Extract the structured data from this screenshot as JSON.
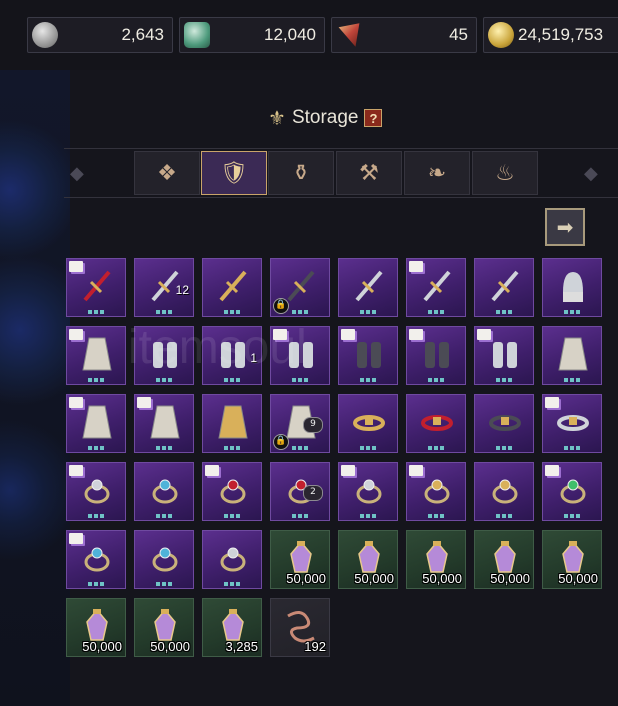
{
  "currencies": [
    {
      "icon": "silver-coin-icon",
      "value": "2,643",
      "color": "#a9a9a9"
    },
    {
      "icon": "green-crystal-icon",
      "value": "12,040",
      "color": "#3e8b6a"
    },
    {
      "icon": "red-gem-icon",
      "value": "45",
      "color": "#c0453a"
    },
    {
      "icon": "gold-coin-icon",
      "value": "24,519,753",
      "color": "#c9a43a"
    }
  ],
  "storage": {
    "title": "Storage",
    "help": "?"
  },
  "tabs": [
    {
      "name": "tab-all",
      "icon": "grid-icon",
      "active": false
    },
    {
      "name": "tab-equipment",
      "icon": "shield-sword-icon",
      "active": true
    },
    {
      "name": "tab-consumables",
      "icon": "potion-icon",
      "active": false
    },
    {
      "name": "tab-crafting",
      "icon": "anvil-icon",
      "active": false
    },
    {
      "name": "tab-materials",
      "icon": "leaf-icon",
      "active": false
    },
    {
      "name": "tab-misc",
      "icon": "pouch-icon",
      "active": false
    }
  ],
  "watermark": "itemsoul",
  "slots": [
    {
      "item": "crimson-staff",
      "book": true,
      "gems": 3
    },
    {
      "item": "steel-greatsword",
      "gems": 3,
      "count": "12"
    },
    {
      "item": "golden-crossbow",
      "gems": 3
    },
    {
      "item": "dark-crossbow",
      "gems": 3,
      "locked": true
    },
    {
      "item": "scythe",
      "gems": 3
    },
    {
      "item": "crossbow",
      "book": true,
      "gems": 3
    },
    {
      "item": "spear",
      "gems": 3
    },
    {
      "item": "plume-helmet",
      "gems": 3
    },
    {
      "item": "fur-armor",
      "book": true,
      "gems": 3
    },
    {
      "item": "steel-gauntlets",
      "gems": 3
    },
    {
      "item": "leather-gloves",
      "gems": 3,
      "count": "1"
    },
    {
      "item": "brown-gloves",
      "book": true,
      "gems": 3
    },
    {
      "item": "dark-boots",
      "book": true,
      "gems": 3
    },
    {
      "item": "dark-boots",
      "book": true,
      "gems": 3
    },
    {
      "item": "leather-boots",
      "book": true,
      "gems": 3
    },
    {
      "item": "grey-cloak",
      "gems": 3
    },
    {
      "item": "fur-cloak",
      "book": true,
      "gems": 3
    },
    {
      "item": "fur-cloak",
      "book": true,
      "gems": 3
    },
    {
      "item": "gold-robe",
      "gems": 3
    },
    {
      "item": "white-robe",
      "gems": 3,
      "locked": true,
      "count": "9"
    },
    {
      "item": "gold-belt",
      "gems": 3
    },
    {
      "item": "red-belt",
      "gems": 3
    },
    {
      "item": "dark-belt",
      "gems": 3
    },
    {
      "item": "silver-belt",
      "book": true,
      "gems": 3
    },
    {
      "item": "silver-ring",
      "book": true,
      "gems": 3
    },
    {
      "item": "blue-gem-ring",
      "gems": 3
    },
    {
      "item": "ruby-ring",
      "book": true,
      "gems": 3
    },
    {
      "item": "red-ring",
      "gems": 3,
      "count": "2"
    },
    {
      "item": "diamond-ring",
      "book": true,
      "gems": 3
    },
    {
      "item": "gold-ring",
      "book": true,
      "gems": 3
    },
    {
      "item": "yellow-ring",
      "gems": 3
    },
    {
      "item": "emerald-ring",
      "book": true,
      "gems": 3
    },
    {
      "item": "aqua-ring",
      "book": true,
      "gems": 3
    },
    {
      "item": "sapphire-ring",
      "gems": 3
    },
    {
      "item": "plain-ring",
      "gems": 3
    },
    {
      "item": "purple-crystal",
      "green": true,
      "qty": "50,000"
    },
    {
      "item": "purple-crystal",
      "green": true,
      "qty": "50,000"
    },
    {
      "item": "purple-crystal",
      "green": true,
      "qty": "50,000"
    },
    {
      "item": "purple-crystal",
      "green": true,
      "qty": "50,000"
    },
    {
      "item": "purple-crystal",
      "green": true,
      "qty": "50,000"
    },
    {
      "item": "purple-crystal",
      "green": true,
      "qty": "50,000"
    },
    {
      "item": "purple-crystal",
      "green": true,
      "qty": "50,000"
    },
    {
      "item": "purple-crystal",
      "green": true,
      "qty": "3,285"
    },
    {
      "item": "worm",
      "dark": true,
      "qty": "192"
    }
  ]
}
